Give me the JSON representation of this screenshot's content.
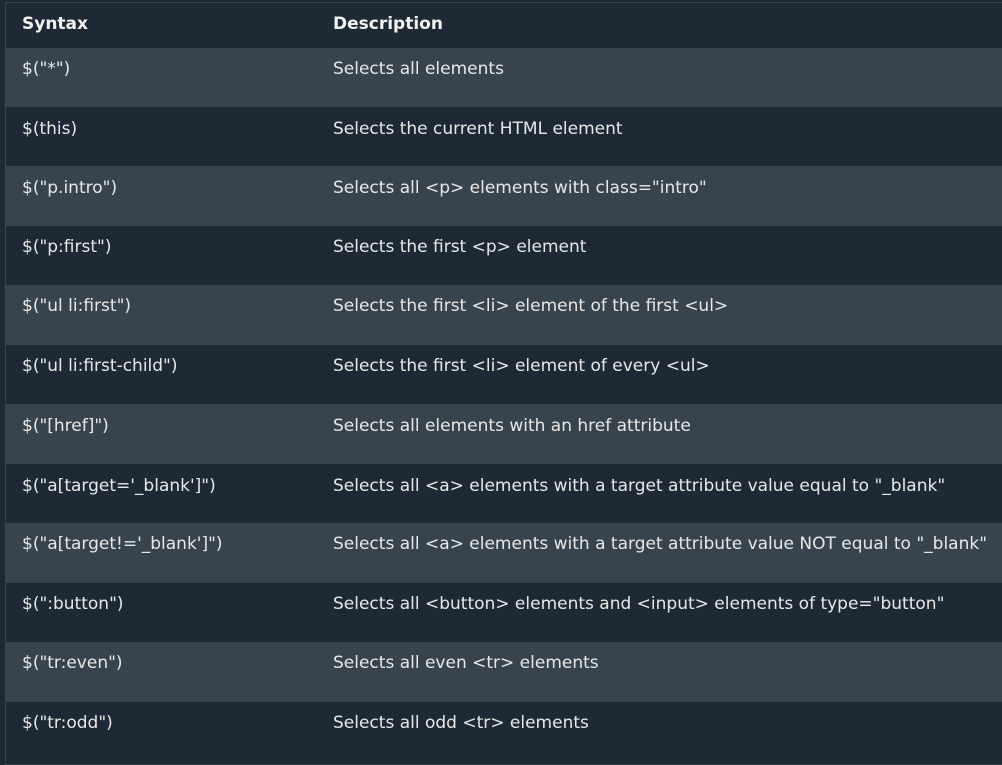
{
  "table": {
    "headers": {
      "syntax": "Syntax",
      "description": "Description"
    },
    "rows": [
      {
        "syntax": "$(\"*\")",
        "description": "Selects all elements"
      },
      {
        "syntax": "$(this)",
        "description": "Selects the current HTML element"
      },
      {
        "syntax": "$(\"p.intro\")",
        "description": "Selects all <p> elements with class=\"intro\""
      },
      {
        "syntax": "$(\"p:first\")",
        "description": "Selects the first <p> element"
      },
      {
        "syntax": "$(\"ul li:first\")",
        "description": "Selects the first <li> element of the first <ul>"
      },
      {
        "syntax": "$(\"ul li:first-child\")",
        "description": "Selects the first <li> element of every <ul>"
      },
      {
        "syntax": "$(\"[href]\")",
        "description": "Selects all elements with an href attribute"
      },
      {
        "syntax": "$(\"a[target='_blank']\")",
        "description": "Selects all <a> elements with a target attribute value equal to \"_blank\""
      },
      {
        "syntax": "$(\"a[target!='_blank']\")",
        "description": "Selects all <a> elements with a target attribute value NOT equal to \"_blank\""
      },
      {
        "syntax": "$(\":button\")",
        "description": "Selects all <button> elements and <input> elements of type=\"button\""
      },
      {
        "syntax": "$(\"tr:even\")",
        "description": "Selects all even <tr> elements"
      },
      {
        "syntax": "$(\"tr:odd\")",
        "description": "Selects all odd <tr> elements"
      }
    ]
  },
  "colors": {
    "background": "#1d2a35",
    "stripe": "#38444d",
    "text": "#e8e8e8"
  }
}
